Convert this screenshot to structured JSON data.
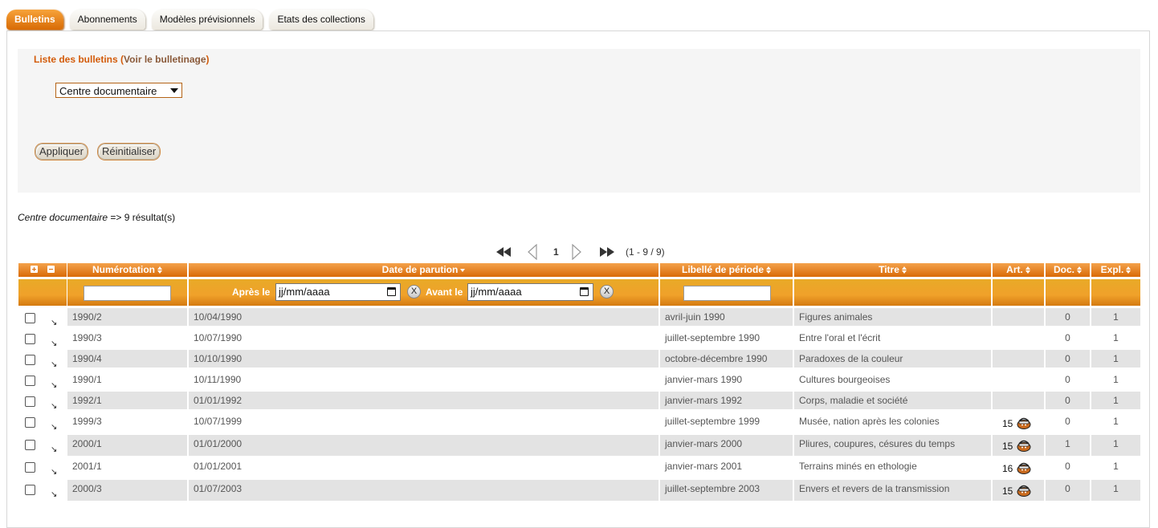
{
  "tabs": [
    {
      "label": "Bulletins",
      "active": true
    },
    {
      "label": "Abonnements",
      "active": false
    },
    {
      "label": "Modèles prévisionnels",
      "active": false
    },
    {
      "label": "Etats des collections",
      "active": false
    }
  ],
  "filter": {
    "title": "Liste des bulletins",
    "title_open": " (",
    "title_link": "Voir le bulletinage",
    "title_close": ")",
    "location_value": "Centre documentaire",
    "apply_label": "Appliquer",
    "reset_label": "Réinitialiser"
  },
  "results": {
    "location": "Centre documentaire",
    "summary": " => 9 résultat(s)"
  },
  "pagination": {
    "current_page": "1",
    "range": "(1 - 9 / 9)"
  },
  "table": {
    "headers": {
      "numerotation": "Numérotation",
      "date": "Date de parution",
      "periode": "Libellé de période",
      "titre": "Titre",
      "art": "Art.",
      "doc": "Doc.",
      "expl": "Expl."
    },
    "filters": {
      "after_label": "Après le",
      "before_label": "Avant le",
      "after_value": "jj/mm/aaaa",
      "before_value": "jj/mm/aaaa",
      "clear_label": "X"
    },
    "rows": [
      {
        "num": "1990/2",
        "date": "10/04/1990",
        "periode": "avril-juin 1990",
        "titre": "Figures animales",
        "art": "",
        "doc": "0",
        "expl": "1"
      },
      {
        "num": "1990/3",
        "date": "10/07/1990",
        "periode": "juillet-septembre 1990",
        "titre": "Entre l'oral et l'écrit",
        "art": "",
        "doc": "0",
        "expl": "1"
      },
      {
        "num": "1990/4",
        "date": "10/10/1990",
        "periode": "octobre-décembre 1990",
        "titre": "Paradoxes de la couleur",
        "art": "",
        "doc": "0",
        "expl": "1"
      },
      {
        "num": "1990/1",
        "date": "10/11/1990",
        "periode": "janvier-mars 1990",
        "titre": "Cultures bourgeoises",
        "art": "",
        "doc": "0",
        "expl": "1"
      },
      {
        "num": "1992/1",
        "date": "01/01/1992",
        "periode": "janvier-mars 1992",
        "titre": "Corps, maladie et société",
        "art": "",
        "doc": "0",
        "expl": "1"
      },
      {
        "num": "1999/3",
        "date": "10/07/1999",
        "periode": "juillet-septembre 1999",
        "titre": "Musée, nation après les colonies",
        "art": "15",
        "doc": "0",
        "expl": "1"
      },
      {
        "num": "2000/1",
        "date": "01/01/2000",
        "periode": "janvier-mars 2000",
        "titre": "Pliures, coupures, césures du temps",
        "art": "15",
        "doc": "1",
        "expl": "1"
      },
      {
        "num": "2001/1",
        "date": "01/01/2001",
        "periode": "janvier-mars 2001",
        "titre": "Terrains minés en ethologie",
        "art": "16",
        "doc": "0",
        "expl": "1"
      },
      {
        "num": "2000/3",
        "date": "01/07/2003",
        "periode": "juillet-septembre 2003",
        "titre": "Envers et revers de la transmission",
        "art": "15",
        "doc": "0",
        "expl": "1"
      }
    ]
  },
  "colors": {
    "accent": "#d96a07",
    "title": "#d35b0a",
    "row_alt": "#e3e3e3"
  },
  "icons": {
    "first_page": "double-left-arrow-icon",
    "prev_page": "left-arrow-icon",
    "next_page": "right-arrow-icon",
    "last_page": "double-right-arrow-icon",
    "expand_all": "plus-icon",
    "collapse_all": "minus-icon",
    "row_expand": "diagonal-arrow-icon",
    "basket": "basket-icon",
    "calendar": "calendar-icon"
  }
}
